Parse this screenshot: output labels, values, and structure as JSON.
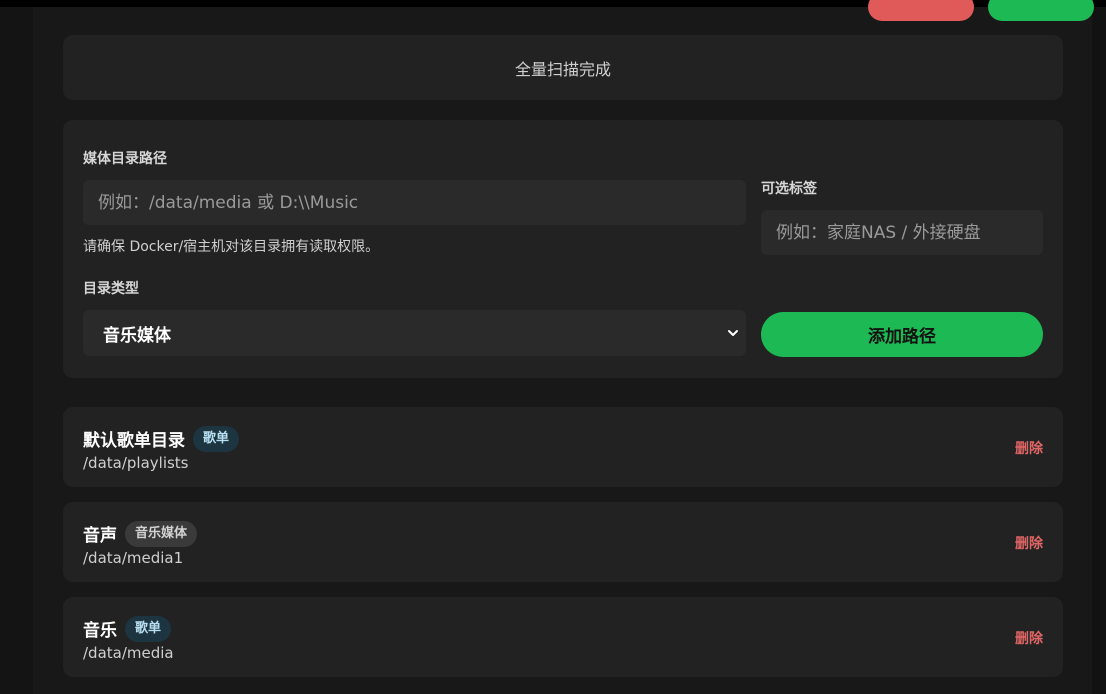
{
  "status": {
    "text": "全量扫描完成"
  },
  "form": {
    "path_label": "媒体目录路径",
    "path_placeholder": "例如：/data/media 或 D:\\\\Music",
    "path_hint": "请确保 Docker/宿主机对该目录拥有读取权限。",
    "tag_label": "可选标签",
    "tag_placeholder": "例如：家庭NAS / 外接硬盘",
    "type_label": "目录类型",
    "type_selected": "音乐媒体",
    "add_button": "添加路径"
  },
  "entries": [
    {
      "name": "默认歌单目录",
      "badge": "歌单",
      "path": "/data/playlists",
      "delete": "删除"
    },
    {
      "name": "音声",
      "badge": "音乐媒体",
      "path": "/data/media1",
      "delete": "删除"
    },
    {
      "name": "音乐",
      "badge": "歌单",
      "path": "/data/media",
      "delete": "删除"
    }
  ],
  "colors": {
    "accent_green": "#1db954",
    "danger_red": "#e05a5a",
    "delete_text": "#e06666",
    "playlist_badge_bg": "#1d3441"
  },
  "icons": {
    "select_arrow": "chevron-down-icon"
  }
}
